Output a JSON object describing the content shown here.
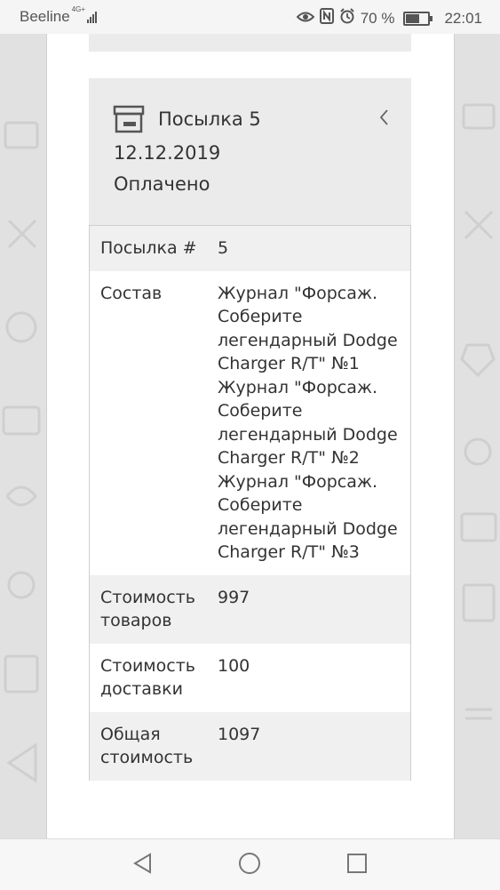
{
  "status_bar": {
    "carrier": "Beeline",
    "network": "4G+",
    "battery_percent": "70 %",
    "battery_level": 0.7,
    "time": "22:01",
    "icons": [
      "eye-icon",
      "nfc-icon",
      "alarm-icon",
      "battery-icon"
    ]
  },
  "parcel": {
    "title": "Посылка 5",
    "date": "12.12.2019",
    "status": "Оплачено",
    "icon": "box-icon",
    "toggle_icon": "chevron-left-icon"
  },
  "details": {
    "rows": [
      {
        "label": "Посылка #",
        "value": "5"
      },
      {
        "label": "Состав",
        "value_lines": [
          "Журнал \"Форсаж. Соберите легендарный Dodge Charger R/T\" №1",
          "Журнал \"Форсаж. Соберите легендарный Dodge Charger R/T\" №2",
          "Журнал \"Форсаж. Соберите легендарный Dodge Charger R/T\" №3"
        ]
      },
      {
        "label": "Стоимость товаров",
        "value": "997"
      },
      {
        "label": "Стоимость доставки",
        "value": "100"
      },
      {
        "label": "Общая стоимость",
        "value": "1097"
      }
    ]
  },
  "nav_bar": {
    "buttons": [
      "back-icon",
      "home-icon",
      "recents-icon"
    ]
  }
}
